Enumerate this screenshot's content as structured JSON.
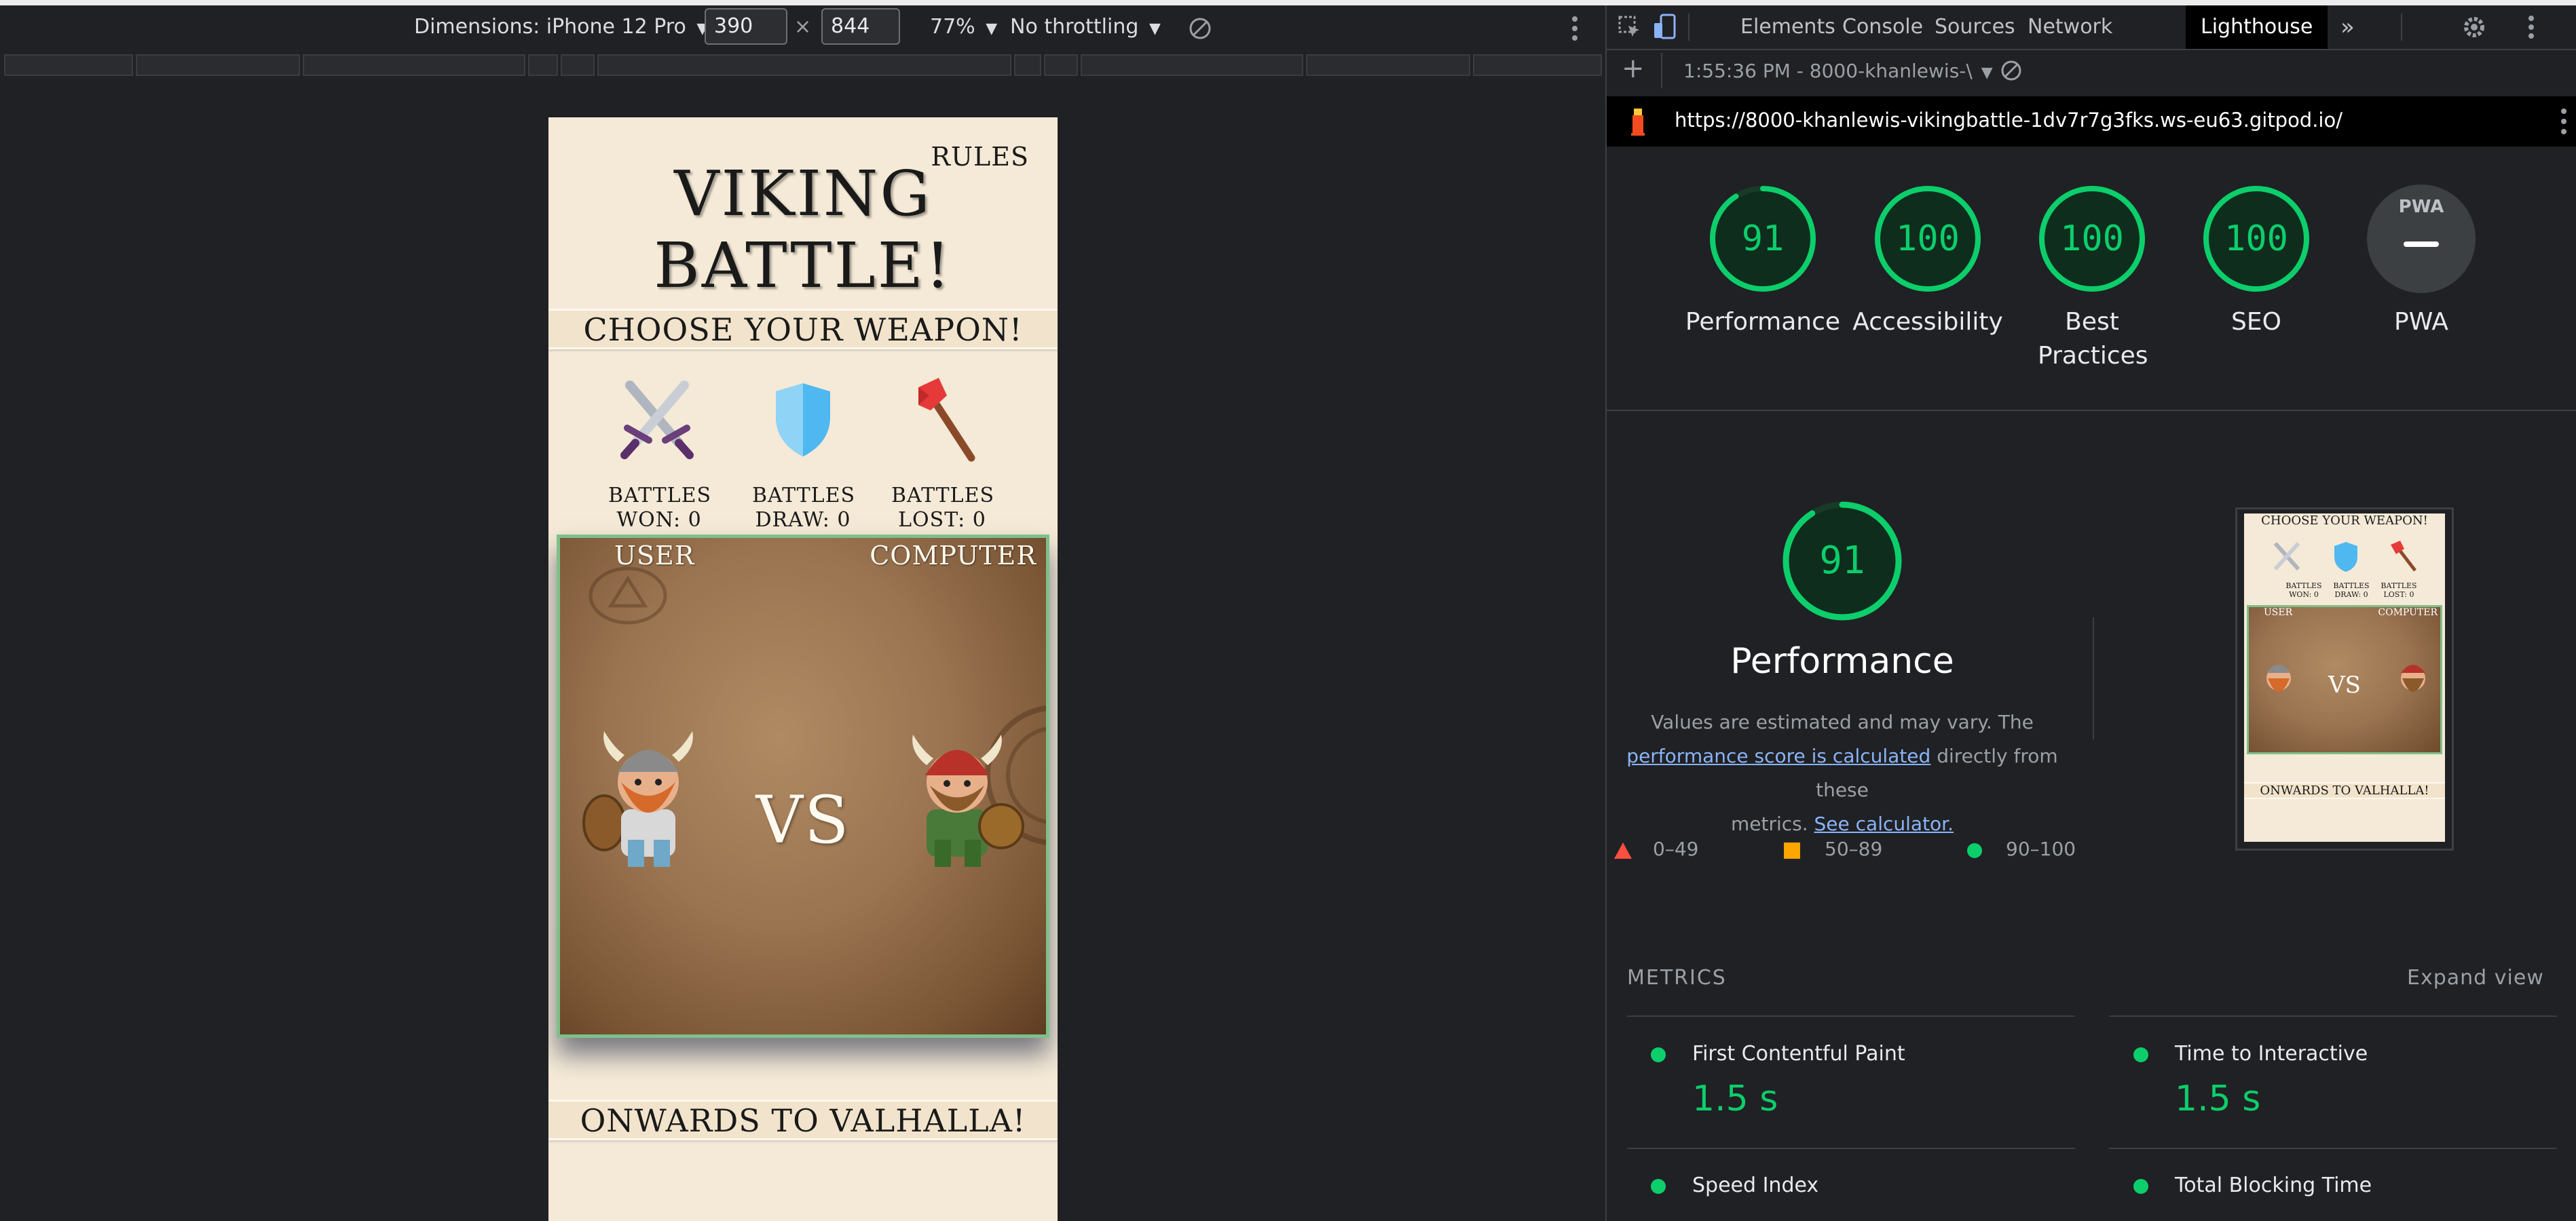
{
  "device_toolbar": {
    "dimensions_label": "Dimensions: iPhone 12 Pro",
    "width": "390",
    "times": "×",
    "height": "844",
    "zoom": "77%",
    "throttling": "No throttling"
  },
  "page": {
    "rules": "RULES",
    "title_line1": "VIKING",
    "title_line2": "BATTLE!",
    "choose": "CHOOSE YOUR WEAPON!",
    "weapons": [
      "swords-icon",
      "shield-icon",
      "axe-icon"
    ],
    "stats": [
      {
        "line1": "BATTLES",
        "line2": "WON: 0"
      },
      {
        "line1": "BATTLES",
        "line2": "DRAW: 0"
      },
      {
        "line1": "BATTLES",
        "line2": "LOST: 0"
      }
    ],
    "user_label": "USER",
    "computer_label": "COMPUTER",
    "vs": "VS",
    "footer": "ONWARDS TO VALHALLA!"
  },
  "devtools": {
    "tabs": [
      "Elements",
      "Console",
      "Sources",
      "Network",
      "Lighthouse"
    ],
    "active_tab": "Lighthouse",
    "report_time": "1:55:36 PM - 8000-khanlewis-\\",
    "url": "https://8000-khanlewis-vikingbattle-1dv7r7g3fks.ws-eu63.gitpod.io/",
    "scores": [
      {
        "label": "Performance",
        "value": 91
      },
      {
        "label": "Accessibility",
        "value": 100
      },
      {
        "label": "Best Practices",
        "value": 100
      },
      {
        "label": "SEO",
        "value": 100
      },
      {
        "label": "PWA",
        "value": null
      }
    ],
    "pwa_badge": "PWA",
    "perf_score": 91,
    "perf_title": "Performance",
    "perf_desc_1": "Values are estimated and may vary. The",
    "perf_desc_link": "performance score is calculated",
    "perf_desc_2": "directly from these",
    "perf_desc_3": "metrics.",
    "perf_desc_calc": "See calculator.",
    "legend": [
      "0–49",
      "50–89",
      "90–100"
    ],
    "thumb_choose": "CHOOSE YOUR WEAPON!",
    "thumb_stats": [
      "BATTLES WON: 0",
      "BATTLES DRAW: 0",
      "BATTLES LOST: 0"
    ],
    "thumb_user": "USER",
    "thumb_computer": "COMPUTER",
    "thumb_vs": "VS",
    "thumb_footer": "ONWARDS TO VALHALLA!",
    "metrics_heading": "METRICS",
    "expand_view": "Expand view",
    "metrics": [
      {
        "name": "First Contentful Paint",
        "value": "1.5 s"
      },
      {
        "name": "Time to Interactive",
        "value": "1.5 s"
      },
      {
        "name": "Speed Index",
        "value": ""
      },
      {
        "name": "Total Blocking Time",
        "value": ""
      }
    ],
    "colors": {
      "pass": "#0cce6b",
      "average": "#ffa400",
      "fail": "#ff4e42"
    }
  }
}
